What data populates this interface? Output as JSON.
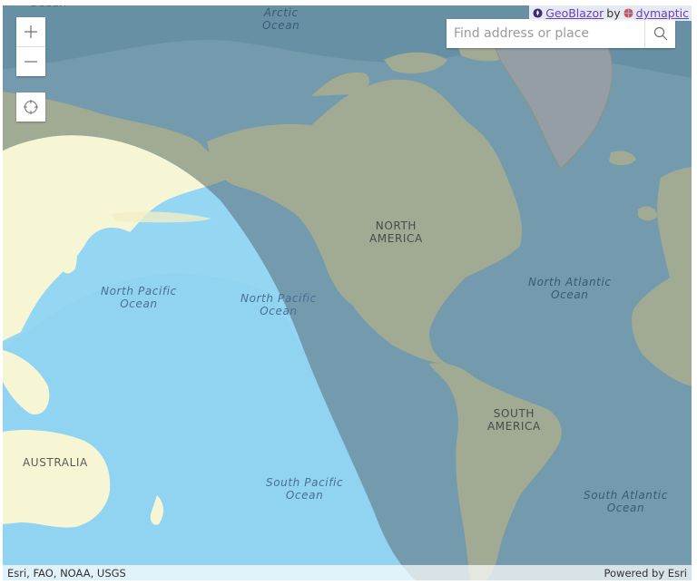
{
  "map": {
    "view": "world-web-mercator",
    "overlay": "day-night-terminator",
    "colors": {
      "ocean": "#a9c9d6",
      "land": "#dcdcb4",
      "night_shade": "#2c4e66",
      "day_ocean": "#95d6f2",
      "day_land": "#f6f6d4",
      "greenland": "#bdbdbd"
    },
    "labels": {
      "arctic_ocean": "Arctic\nOcean",
      "top_left_ocean": "Ocean",
      "north_america": "NORTH\nAMERICA",
      "south_america": "SOUTH\nAMERICA",
      "australia": "AUSTRALIA",
      "north_pacific_west": "North Pacific\nOcean",
      "north_pacific_east": "North Pacific\nOcean",
      "north_atlantic": "North Atlantic\nOcean",
      "south_pacific": "South Pacific\nOcean",
      "south_atlantic": "South Atlantic\nOcean"
    }
  },
  "controls": {
    "zoom_in_icon": "plus-icon",
    "zoom_out_icon": "minus-icon",
    "locate_icon": "crosshair-icon",
    "search": {
      "placeholder": "Find address or place",
      "value": "",
      "button_icon": "search-icon"
    }
  },
  "badge": {
    "product_link": "GeoBlazor",
    "by_text": "by",
    "company_link": "dymaptic"
  },
  "attribution": {
    "sources": "Esri, FAO, NOAA, USGS",
    "powered_by": "Powered by Esri"
  }
}
